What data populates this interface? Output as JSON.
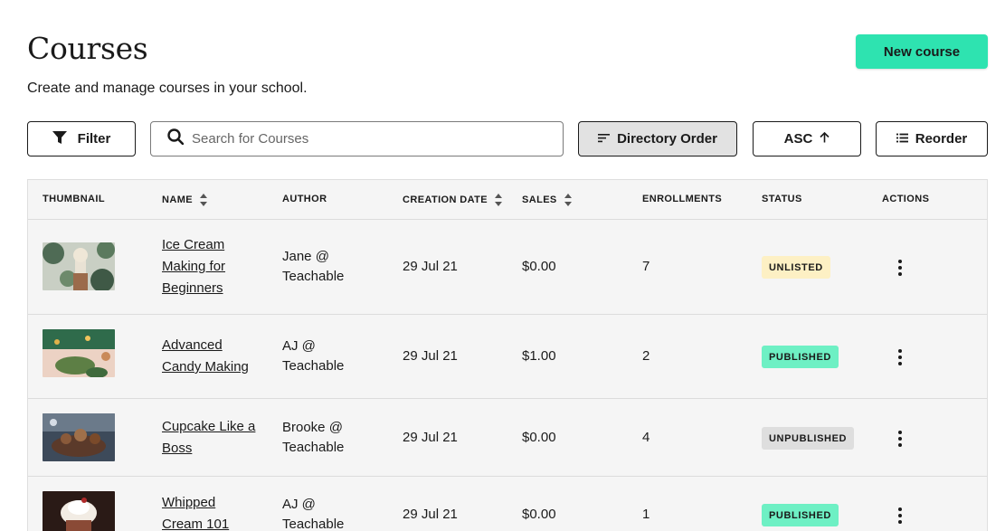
{
  "header": {
    "title": "Courses",
    "subtitle": "Create and manage courses in your school.",
    "new_course_label": "New course"
  },
  "toolbar": {
    "filter_label": "Filter",
    "search_placeholder": "Search for Courses",
    "directory_order_label": "Directory Order",
    "asc_label": "ASC",
    "reorder_label": "Reorder"
  },
  "table": {
    "columns": [
      "THUMBNAIL",
      "NAME",
      "AUTHOR",
      "CREATION DATE",
      "SALES",
      "ENROLLMENTS",
      "STATUS",
      "ACTIONS"
    ],
    "rows": [
      {
        "name": "Ice Cream Making for Beginners",
        "name_lines": [
          "Ice Cream",
          "Making for",
          "Beginners"
        ],
        "author_lines": [
          "Jane @",
          "Teachable"
        ],
        "date": "29 Jul 21",
        "sales": "$0.00",
        "enrollments": "7",
        "status": "UNLISTED"
      },
      {
        "name": "Advanced Candy Making",
        "name_lines": [
          "Advanced",
          "Candy Making"
        ],
        "author_lines": [
          "AJ @",
          "Teachable"
        ],
        "date": "29 Jul 21",
        "sales": "$1.00",
        "enrollments": "2",
        "status": "PUBLISHED"
      },
      {
        "name": "Cupcake Like a Boss",
        "name_lines": [
          "Cupcake Like a",
          "Boss"
        ],
        "author_lines": [
          "Brooke @",
          "Teachable"
        ],
        "date": "29 Jul 21",
        "sales": "$0.00",
        "enrollments": "4",
        "status": "UNPUBLISHED"
      },
      {
        "name": "Whipped Cream 101",
        "name_lines": [
          "Whipped",
          "Cream 101"
        ],
        "author_lines": [
          "AJ @",
          "Teachable"
        ],
        "date": "29 Jul 21",
        "sales": "$0.00",
        "enrollments": "1",
        "status": "PUBLISHED"
      }
    ]
  },
  "colors": {
    "accent": "#2ee3b0",
    "badge_unlisted": "#fdf0c4",
    "badge_published": "#6ef0c4",
    "badge_unpublished": "#dedede"
  }
}
